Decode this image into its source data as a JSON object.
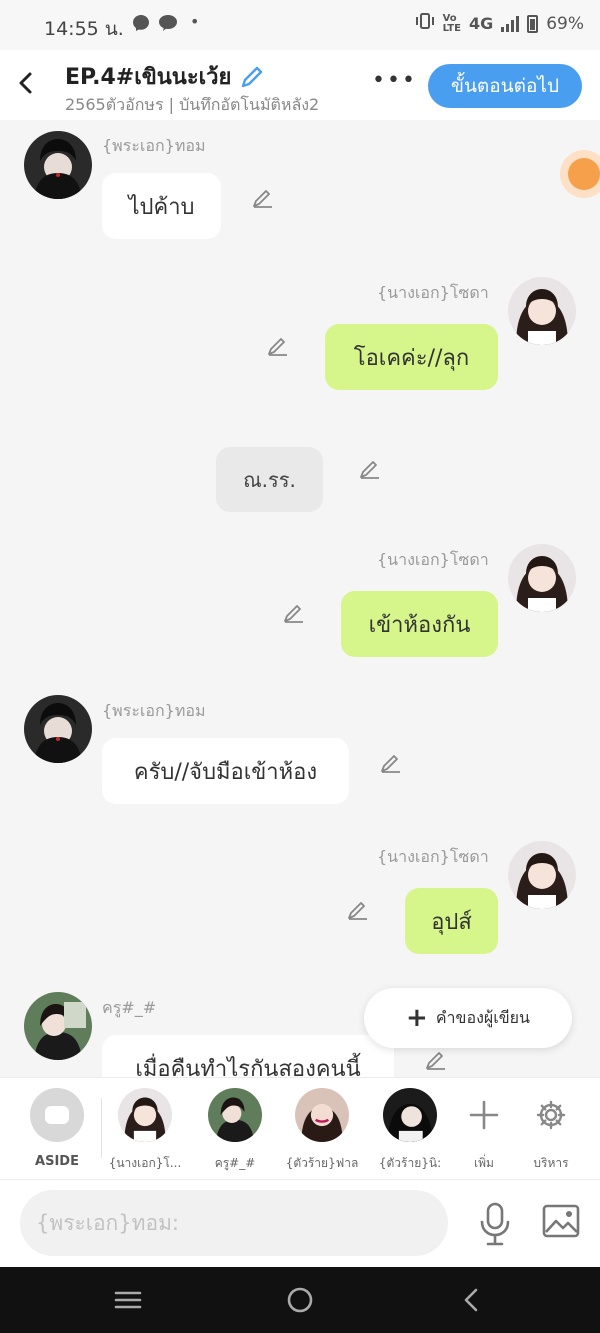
{
  "status_bar": {
    "time": "14:55 น.",
    "network": "4G",
    "battery": "69%"
  },
  "header": {
    "back_icon": "back-arrow-icon",
    "title": "EP.4#เขินนะเว้ย",
    "subtitle": "2565ตัวอักษร | บันทึกอัตโนมัติหลัง2",
    "menu_icon": "more-dots-icon",
    "next_label": "ขั้นตอนต่อไป"
  },
  "messages": [
    {
      "side": "left",
      "name": "{พระเอก}ทอม",
      "text": "ไปค้าบ"
    },
    {
      "side": "right",
      "name": "{นางเอก}โซดา",
      "text": "โอเคค่ะ//ลุก"
    },
    {
      "side": "aside",
      "text": "ณ.รร."
    },
    {
      "side": "right",
      "name": "{นางเอก}โซดา",
      "text": "เข้าห้องกัน"
    },
    {
      "side": "left",
      "name": "{พระเอก}ทอม",
      "text": "ครับ//จับมือเข้าห้อง"
    },
    {
      "side": "right",
      "name": "{นางเอก}โซดา",
      "text": "อุปส์"
    },
    {
      "side": "left",
      "name": "ครู#_#",
      "text": "เมื่อคืนทำไรกันสองคนนี้"
    }
  ],
  "author_button": {
    "label": "คำของผู้เขียน"
  },
  "cast_bar": {
    "aside_label": "ASIDE",
    "characters": [
      "{นางเอก}โ...",
      "ครู#_#",
      "{ตัวร้าย}ฟาล",
      "{ตัวร้าย}นิ:"
    ],
    "add_label": "เพิ่ม",
    "manage_label": "บริหาร"
  },
  "composer": {
    "placeholder": "{พระเอก}ทอม:"
  },
  "colors": {
    "accent": "#4a9ef0",
    "right_bubble": "#d6f58a",
    "aside_bubble": "#e9e9e9"
  }
}
